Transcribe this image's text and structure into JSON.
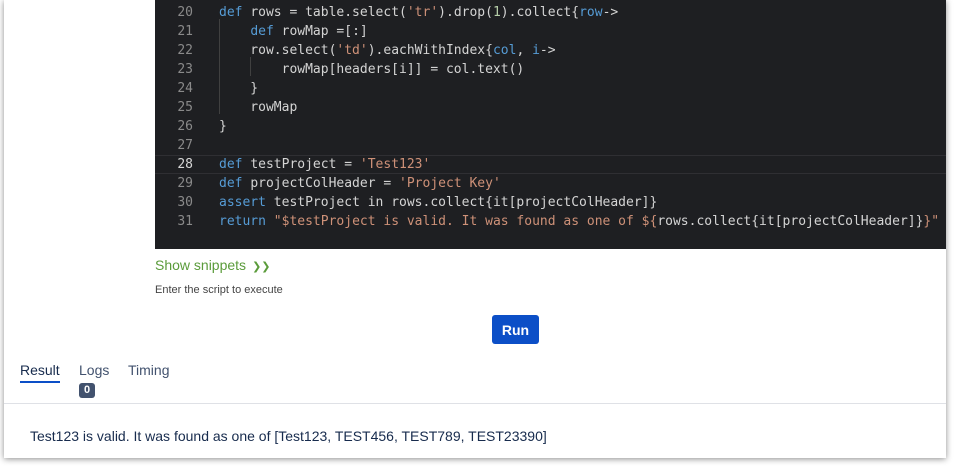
{
  "editor": {
    "lines": [
      {
        "num": "20",
        "segments": [
          {
            "c": "kw",
            "t": "def "
          },
          {
            "c": "tx",
            "t": "rows = table.select("
          },
          {
            "c": "st",
            "t": "'tr'"
          },
          {
            "c": "tx",
            "t": ").drop("
          },
          {
            "c": "nm",
            "t": "1"
          },
          {
            "c": "tx",
            "t": ").collect{"
          },
          {
            "c": "kw",
            "t": "row"
          },
          {
            "c": "tx",
            "t": "->"
          }
        ]
      },
      {
        "num": "21",
        "segments": [
          {
            "c": "tx",
            "t": "    "
          },
          {
            "c": "kw",
            "t": "def "
          },
          {
            "c": "tx",
            "t": "rowMap =[:]"
          }
        ]
      },
      {
        "num": "22",
        "segments": [
          {
            "c": "tx",
            "t": "    row.select("
          },
          {
            "c": "st",
            "t": "'td'"
          },
          {
            "c": "tx",
            "t": ").eachWithIndex{"
          },
          {
            "c": "kw",
            "t": "col"
          },
          {
            "c": "tx",
            "t": ", "
          },
          {
            "c": "kw",
            "t": "i"
          },
          {
            "c": "tx",
            "t": "->"
          }
        ]
      },
      {
        "num": "23",
        "segments": [
          {
            "c": "tx",
            "t": "        rowMap[headers[i]] = col.text()"
          }
        ]
      },
      {
        "num": "24",
        "segments": [
          {
            "c": "tx",
            "t": "    }"
          }
        ]
      },
      {
        "num": "25",
        "segments": [
          {
            "c": "tx",
            "t": "    rowMap"
          }
        ]
      },
      {
        "num": "26",
        "segments": [
          {
            "c": "tx",
            "t": "}"
          }
        ]
      },
      {
        "num": "27",
        "segments": []
      },
      {
        "num": "28",
        "active": true,
        "segments": [
          {
            "c": "kw",
            "t": "def "
          },
          {
            "c": "tx",
            "t": "testProject = "
          },
          {
            "c": "st",
            "t": "'Test123'"
          }
        ]
      },
      {
        "num": "29",
        "segments": [
          {
            "c": "kw",
            "t": "def "
          },
          {
            "c": "tx",
            "t": "projectColHeader = "
          },
          {
            "c": "st",
            "t": "'Project Key'"
          }
        ]
      },
      {
        "num": "30",
        "segments": [
          {
            "c": "kw",
            "t": "assert "
          },
          {
            "c": "tx",
            "t": "testProject in rows.collect{it[projectColHeader]}"
          }
        ]
      },
      {
        "num": "31",
        "segments": [
          {
            "c": "kw",
            "t": "return "
          },
          {
            "c": "st",
            "t": "\"$testProject is valid. It was found as one of ${"
          },
          {
            "c": "tx",
            "t": "rows.collect{it[projectColHeader]}"
          },
          {
            "c": "st",
            "t": "}\""
          }
        ]
      }
    ]
  },
  "snippets": {
    "label": "Show snippets"
  },
  "hint": "Enter the script to execute",
  "run_button": {
    "label": "Run"
  },
  "tabs": [
    {
      "label": "Result",
      "active": true
    },
    {
      "label": "Logs",
      "badge": "0"
    },
    {
      "label": "Timing"
    }
  ],
  "result_text": "Test123 is valid. It was found as one of [Test123, TEST456, TEST789, TEST23390]",
  "colors": {
    "accent": "#0c4fc7",
    "snippets": "#5a9b3a",
    "editor_bg": "#1e1f22"
  }
}
